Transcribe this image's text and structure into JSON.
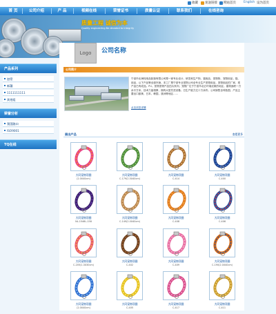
{
  "topbar": {
    "links": [
      "收藏",
      "发送链接",
      "网站首页",
      "English",
      "设为首页"
    ],
    "colors": {
      "icon": "#2b7bc4"
    }
  },
  "nav": {
    "items": [
      "首 页",
      "公司介绍",
      "产 品",
      "视频在线",
      "荣誉证书",
      "质量认证",
      "联系我们",
      "在线咨询"
    ],
    "colors": {
      "from": "#5bb0ea",
      "to": "#1e77c8"
    }
  },
  "banner": {
    "slogan": "质量工程  诚信为本",
    "slogan_en": "Quality engineering    Be devoted to integrity",
    "colors": {
      "slogan": "#f6c000"
    }
  },
  "company": {
    "logo_text": "Logo",
    "name": "公司名称"
  },
  "sidebar": {
    "sections": [
      {
        "title": "产品系列",
        "items": [
          "加密",
          "新疆",
          "1111111111",
          "其他组"
        ]
      },
      {
        "title": "荣誉分析",
        "items": [
          "我国路口",
          "ISO9001"
        ]
      },
      {
        "title": "TQ在线",
        "items": []
      }
    ]
  },
  "intro": {
    "bar_title": "公司简介",
    "text": "宁波市北海特用品制造有限公司是一家专业设计、研发和生产狗、猫用品、宠物狗、宠物用品，猫、用品，以下产品等全部外销，本工厂是宁波专业宠物公司全专业生产宠物用品，宠物用品的厂家，现产品已有成品。PU。宠物宠物产品四大系列，宠物厂位于宁波市北仑环境优美的地区，建筑面积一万余平方米，技术力量雄厚，拥有大型先进设备，日生产能力达十万余件。公司销售全球各国，产品主要出口欧美、日本、韩国，澳洲等地区……",
    "more": "点击浏览详情"
  },
  "products": {
    "title": "展出产品",
    "more": "查看更多",
    "items": [
      {
        "name": "大同宠物项圈",
        "code": "(2.0X40cm)",
        "theme": "rainbow"
      },
      {
        "name": "大同宠物项圈",
        "code": "C-179(2.5X40cm)",
        "theme": "green"
      },
      {
        "name": "大同宠物项圈",
        "code": "C-414",
        "theme": "leopard"
      },
      {
        "name": "大同宠物项圈",
        "code": "C-400",
        "theme": "blue"
      },
      {
        "name": "大同宠物项圈",
        "code": "NL-1546L-158",
        "theme": "leash"
      },
      {
        "name": "大同宠物项圈",
        "code": "C-149(2.0X40cm)",
        "theme": "tan"
      },
      {
        "name": "大同宠物项圈",
        "code": "C-408",
        "theme": "orange"
      },
      {
        "name": "大同宠物项圈",
        "code": "C-406",
        "theme": "dots"
      },
      {
        "name": "大同宠物项圈",
        "code": "C-205(1.3X30cm)",
        "theme": "multi"
      },
      {
        "name": "大同宠物项圈",
        "code": "C-402",
        "theme": "brown"
      },
      {
        "name": "大同宠物项圈",
        "code": "C-409",
        "theme": "pink"
      },
      {
        "name": "大同宠物项圈",
        "code": "C-190(2.0X40cm)",
        "theme": "orange2"
      },
      {
        "name": "大同宠物项圈",
        "code": "(2.0X40cm)",
        "theme": "blue2"
      },
      {
        "name": "大同宠物项圈",
        "code": "C-405",
        "theme": "yellow"
      },
      {
        "name": "大同宠物项圈",
        "code": "C-417",
        "theme": "flower"
      },
      {
        "name": "大同宠物项圈",
        "code": "C-411",
        "theme": "gold"
      }
    ]
  }
}
